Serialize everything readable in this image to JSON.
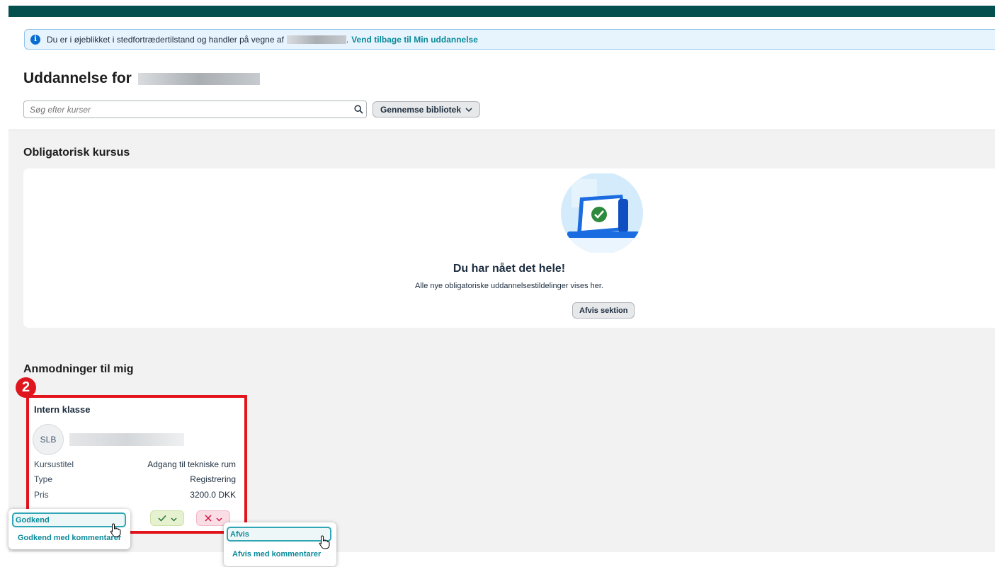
{
  "banner": {
    "text": "Du er i øjeblikket i stedfortrædertilstand og handler på vegne af",
    "link": "Vend tilbage til Min uddannelse"
  },
  "header": {
    "title": "Uddannelse for",
    "search_placeholder": "Søg efter kurser",
    "browse_label": "Gennemse bibliotek"
  },
  "mandatory": {
    "section_title": "Obligatorisk kursus",
    "empty_title": "Du har nået det hele!",
    "empty_subtitle": "Alle nye obligatoriske uddannelsestildelinger vises her.",
    "dismiss_label": "Afvis sektion"
  },
  "requests": {
    "section_title": "Anmodninger til mig",
    "callout_number": "2",
    "card": {
      "type": "Intern klasse",
      "avatar_initials": "SLB",
      "fields": [
        {
          "label": "Kursustitel",
          "value": "Adgang til tekniske rum"
        },
        {
          "label": "Type",
          "value": "Registrering"
        },
        {
          "label": "Pris",
          "value": "3200.0 DKK"
        }
      ]
    },
    "approve_menu": [
      "Godkend",
      "Godkend med kommentarer"
    ],
    "reject_menu": [
      "Afvis",
      "Afvis med kommentarer"
    ]
  },
  "colors": {
    "brand": "#04504e",
    "accent_link": "#0a8a9a",
    "callout_red": "#e2141c",
    "approve_green": "#256f3a",
    "reject_red": "#d0103a"
  }
}
